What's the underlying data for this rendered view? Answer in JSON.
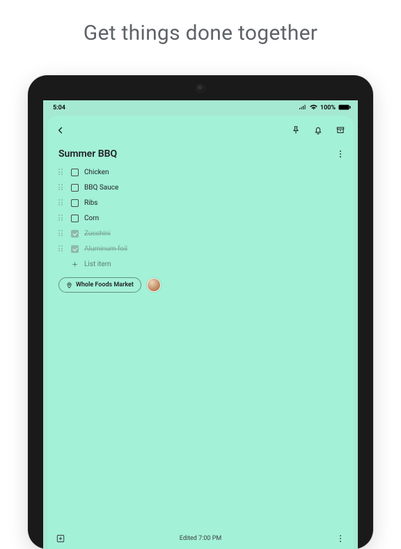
{
  "headline": "Get things done together",
  "statusbar": {
    "time": "5:04",
    "battery_pct": "100%"
  },
  "note": {
    "title": "Summer BBQ",
    "items": [
      {
        "label": "Chicken",
        "checked": false
      },
      {
        "label": "BBQ Sauce",
        "checked": false
      },
      {
        "label": "Ribs",
        "checked": false
      },
      {
        "label": "Corn",
        "checked": false
      },
      {
        "label": "Zucchini",
        "checked": true
      },
      {
        "label": "Aluminum foil",
        "checked": true
      }
    ],
    "add_placeholder": "List item",
    "location_chip": "Whole Foods Market",
    "bottom": {
      "edited": "Edited 7:00 PM"
    }
  },
  "icons": {
    "back": "back-icon",
    "pin": "pin-icon",
    "reminder": "bell-icon",
    "archive": "archive-icon",
    "overflow": "more-vert-icon",
    "add_box": "add-box-icon",
    "location": "location-icon",
    "plus": "plus-icon"
  }
}
